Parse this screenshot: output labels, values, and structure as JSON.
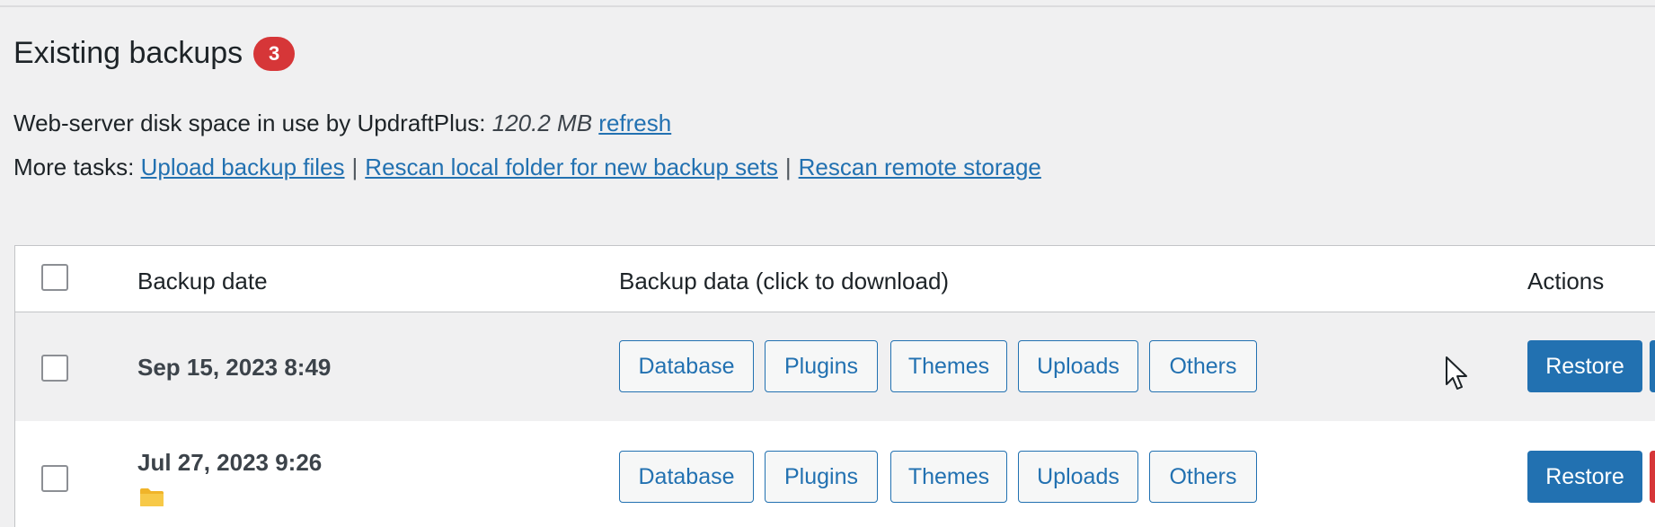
{
  "section": {
    "title": "Existing backups",
    "count": "3"
  },
  "disk": {
    "label": "Web-server disk space in use by UpdraftPlus:",
    "usage": "120.2 MB",
    "refresh_link": "refresh"
  },
  "tasks": {
    "label": "More tasks:",
    "links": [
      "Upload backup files",
      "Rescan local folder for new backup sets",
      "Rescan remote storage"
    ],
    "separator": "|"
  },
  "table": {
    "columns": {
      "date": "Backup date",
      "data": "Backup data (click to download)",
      "actions": "Actions"
    },
    "rows": [
      {
        "date": "Sep 15, 2023 8:49",
        "downloads": [
          "Database",
          "Plugins",
          "Themes",
          "Uploads",
          "Others"
        ],
        "restore_label": "Restore"
      },
      {
        "date": "Jul 27, 2023 9:26",
        "downloads": [
          "Database",
          "Plugins",
          "Themes",
          "Uploads",
          "Others"
        ],
        "restore_label": "Restore",
        "has_folder_icon": true
      }
    ]
  },
  "colors": {
    "accent": "#2271b1",
    "badge": "#d63638",
    "background": "#f0f0f1",
    "folder": "#f0b429"
  },
  "icons": {
    "folder": "folder-icon",
    "cursor": "mouse-pointer-icon"
  }
}
